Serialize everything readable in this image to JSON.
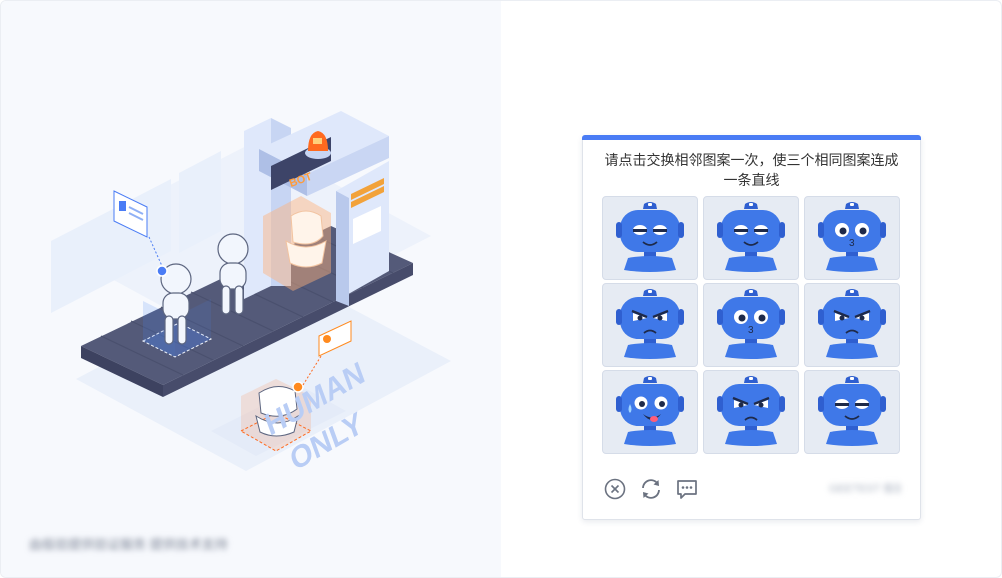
{
  "illustration": {
    "bot_sign": "BOT",
    "human_text_1": "HUMAN",
    "human_text_2": "ONLY"
  },
  "footer": {
    "note": "由极验提供验证服务 提供技术支持"
  },
  "captcha": {
    "instruction": "请点击交换相邻图案一次，使三个相同图案连成一条直线",
    "tiles": [
      {
        "face": "smile-squint"
      },
      {
        "face": "smile-squint"
      },
      {
        "face": "surprised"
      },
      {
        "face": "angry"
      },
      {
        "face": "surprised"
      },
      {
        "face": "angry"
      },
      {
        "face": "silly"
      },
      {
        "face": "angry"
      },
      {
        "face": "smile-squint"
      }
    ],
    "actions": {
      "close_icon": "close-circle-icon",
      "refresh_icon": "refresh-icon",
      "feedback_icon": "feedback-icon"
    },
    "brand": "GEETEST 极验"
  },
  "colors": {
    "accent": "#4a7cf5",
    "bot_blue": "#3f78e8",
    "bot_dark": "#2f5fd0",
    "tile_bg": "#e6ebf3",
    "orange": "#ff6a1f"
  }
}
